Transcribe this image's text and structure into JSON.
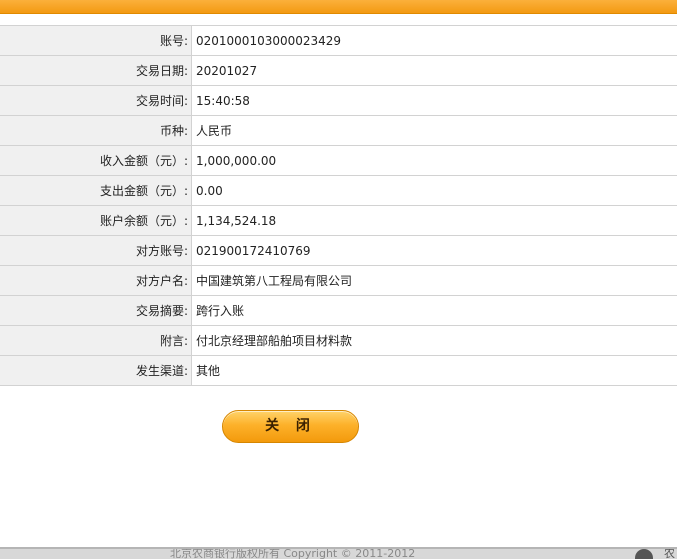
{
  "rows": [
    {
      "label": "账号:",
      "value": "0201000103000023429"
    },
    {
      "label": "交易日期:",
      "value": "20201027"
    },
    {
      "label": "交易时间:",
      "value": "15:40:58"
    },
    {
      "label": "币种:",
      "value": "人民币"
    },
    {
      "label": "收入金额（元）:",
      "value": "1,000,000.00"
    },
    {
      "label": "支出金额（元）:",
      "value": "0.00"
    },
    {
      "label": "账户余额（元）:",
      "value": "1,134,524.18"
    },
    {
      "label": "对方账号:",
      "value": "021900172410769"
    },
    {
      "label": "对方户名:",
      "value": "中国建筑第八工程局有限公司"
    },
    {
      "label": "交易摘要:",
      "value": "跨行入账"
    },
    {
      "label": "附言:",
      "value": "付北京经理部船舶项目材料款"
    },
    {
      "label": "发生渠道:",
      "value": "其他"
    }
  ],
  "actions": {
    "close_label": "关 闭"
  },
  "footer": {
    "copyright": "北京农商银行版权所有 Copyright © 2011-2012",
    "logo_text": "农"
  },
  "colors": {
    "accent": "#f7a21b",
    "label_bg": "#f0f0f0",
    "border": "#d2d2d2"
  }
}
